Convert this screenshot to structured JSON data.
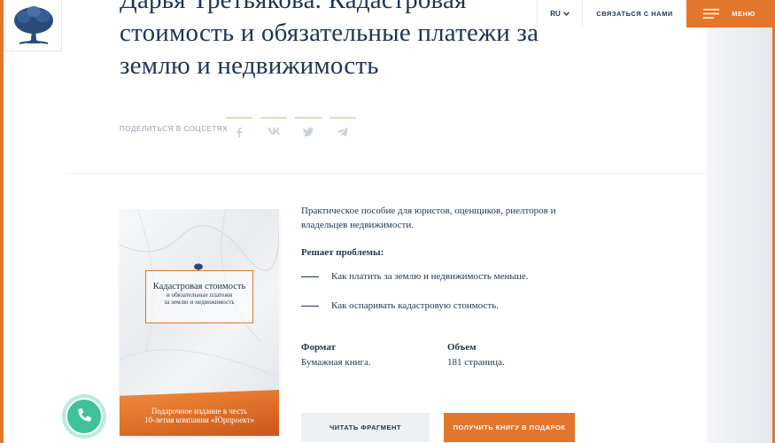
{
  "header": {
    "lang": "RU",
    "contact_label": "СВЯЗАТЬСЯ С НАМИ",
    "menu_label": "МЕНЮ"
  },
  "article": {
    "title_line1": "Дарья Третьякова. Кадастровая",
    "title_line2": "стоимость и обязательные платежи за",
    "title_line3": "землю и недвижимость"
  },
  "share": {
    "label": "ПОДЕЛИТЬСЯ В СОЦСЕТЯХ",
    "icons": [
      "facebook-icon",
      "vk-icon",
      "twitter-icon",
      "telegram-icon"
    ]
  },
  "cover": {
    "title": "Кадастровая стоимость",
    "subtitle_line1": "и обязательные платежи",
    "subtitle_line2": "за землю и недвижимость",
    "band_line1": "Подарочное издание в честь",
    "band_line2": "10-летия компании «Юрпроект»"
  },
  "book": {
    "intro": "Практическое пособие для юристов, оценщиков, риелторов и владельцев недвижимости.",
    "solves_label": "Решает проблемы:",
    "problems": [
      "Как платить за землю и недвижимость меньше.",
      "Как оспаривать кадастровую стоимость."
    ],
    "format_label": "Формат",
    "format_value": "Бумажная книга.",
    "volume_label": "Объем",
    "volume_value": "181 страница."
  },
  "actions": {
    "read_fragment": "ЧИТАТЬ ФРАГМЕНТ",
    "get_gift": "ПОЛУЧИТЬ КНИГУ В ПОДАРОК"
  },
  "colors": {
    "accent": "#e2762c",
    "text": "#1f3552",
    "phone": "#3fc29a"
  }
}
